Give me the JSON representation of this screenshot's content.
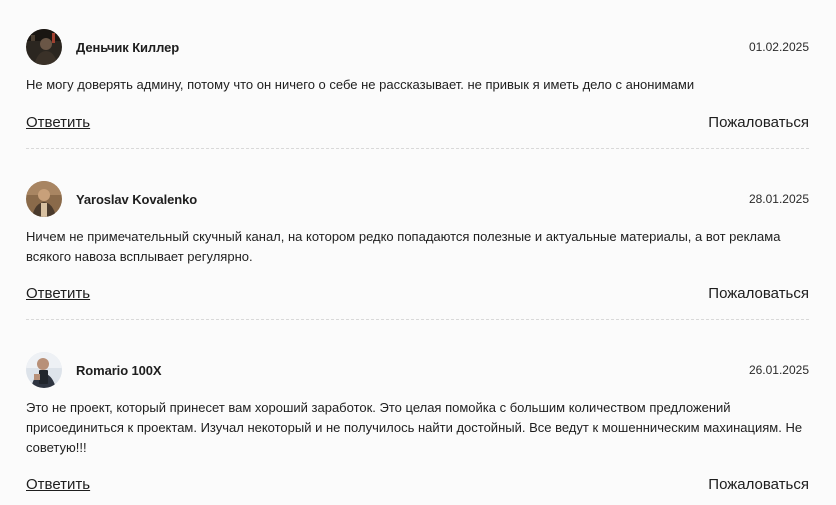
{
  "comments": [
    {
      "author": "Деньчик Киллер",
      "date": "01.02.2025",
      "text": "Не могу доверять админу, потому что он ничего о себе не рассказывает. не привык я иметь дело с анонимами",
      "reply_label": "Ответить",
      "report_label": "Пожаловаться"
    },
    {
      "author": "Yaroslav Kovalenko",
      "date": "28.01.2025",
      "text": "Ничем не примечательный скучный канал, на котором редко попадаются полезные и актуальные материалы, а вот реклама всякого навоза всплывает регулярно.",
      "reply_label": "Ответить",
      "report_label": "Пожаловаться"
    },
    {
      "author": "Romario 100X",
      "date": "26.01.2025",
      "text": "Это не проект, который принесет вам хороший заработок. Это целая помойка с большим количеством предложений присоединиться к проектам. Изучал некоторый и не получилось найти достойный. Все ведут к мошенническим махинациям. Не советую!!!",
      "reply_label": "Ответить",
      "report_label": "Пожаловаться"
    }
  ]
}
